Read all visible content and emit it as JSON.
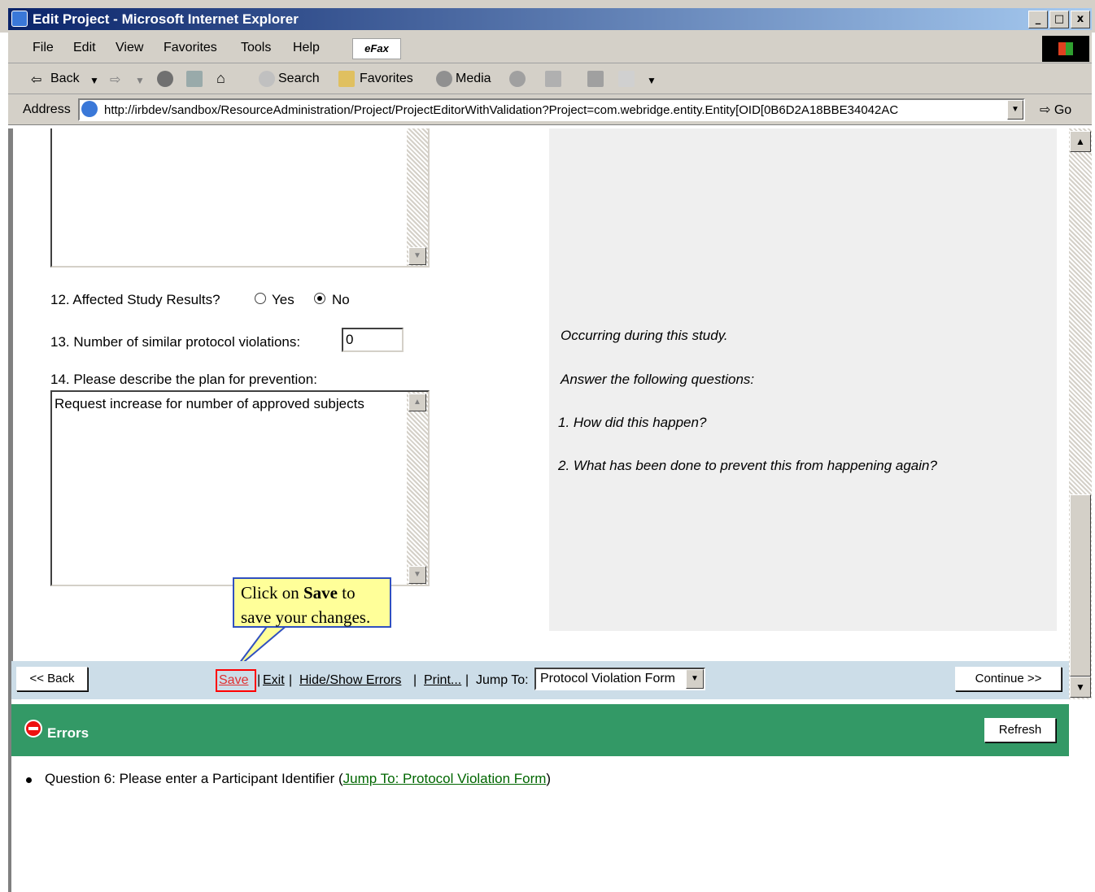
{
  "window": {
    "title": "Edit Project - Microsoft Internet Explorer",
    "minimize": "_",
    "maximize": "□",
    "close": "x"
  },
  "menu": {
    "file": "File",
    "edit": "Edit",
    "view": "View",
    "favorites": "Favorites",
    "tools": "Tools",
    "help": "Help",
    "efax": "eFax"
  },
  "toolbar": {
    "back": "Back",
    "search": "Search",
    "favorites": "Favorites",
    "media": "Media"
  },
  "address": {
    "label": "Address",
    "url": "http://irbdev/sandbox/ResourceAdministration/Project/ProjectEditorWithValidation?Project=com.webridge.entity.Entity[OID[0B6D2A18BBE34042AC",
    "go": "Go"
  },
  "form": {
    "q12_label": "12.  Affected Study Results?",
    "q12_yes": "Yes",
    "q12_no": "No",
    "q12_selected": "No",
    "q13_label": "13.  Number of similar protocol violations:",
    "q13_value": "0",
    "q14_label": "14.  Please describe the plan for prevention:",
    "q14_value": "Request increase for number of approved subjects"
  },
  "help": {
    "line1": "Occurring during this study.",
    "line2": "Answer the following questions:",
    "line3": "1. How did this happen?",
    "line4": "2. What has been done to prevent this from happening again?"
  },
  "callout": {
    "text_pre": "Click on ",
    "text_bold": "Save",
    "text_post": " to save your changes."
  },
  "nav": {
    "back": "<< Back",
    "save": "Save",
    "exit": "Exit",
    "hide_show_errors": "Hide/Show Errors",
    "print": "Print...",
    "jump_to_label": "Jump To:",
    "jump_to_value": "Protocol Violation Form",
    "continue": "Continue >>"
  },
  "errors": {
    "title": "Errors",
    "refresh": "Refresh",
    "items": [
      {
        "text": "Question 6: Please enter a Participant Identifier (",
        "link": "Jump To: Protocol Violation Form",
        "suffix": ")"
      }
    ]
  },
  "colors": {
    "errors_bar": "#339966",
    "nav_bar": "#ccdde8",
    "help_panel": "#efefef",
    "save_highlight": "#ff0000",
    "callout_bg": "#ffff99"
  }
}
